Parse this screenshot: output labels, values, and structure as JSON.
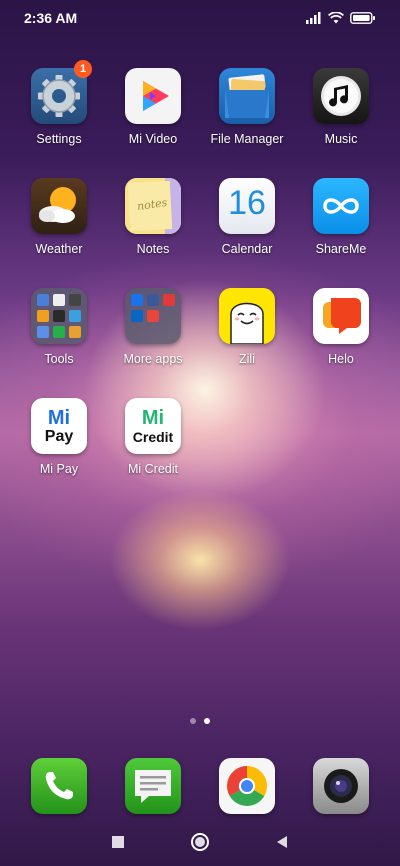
{
  "status": {
    "time": "2:36 AM",
    "icons": [
      "signal-icon",
      "wifi-icon",
      "battery-icon"
    ]
  },
  "apps": [
    {
      "label": "Settings",
      "icon": "settings-gear-icon",
      "badge": "1"
    },
    {
      "label": "Mi Video",
      "icon": "mi-video-icon"
    },
    {
      "label": "File Manager",
      "icon": "file-manager-icon"
    },
    {
      "label": "Music",
      "icon": "music-icon"
    },
    {
      "label": "Weather",
      "icon": "weather-icon"
    },
    {
      "label": "Notes",
      "icon": "notes-icon",
      "tile_text": "notes"
    },
    {
      "label": "Calendar",
      "icon": "calendar-icon",
      "tile_text": "16"
    },
    {
      "label": "ShareMe",
      "icon": "shareme-icon"
    },
    {
      "label": "Tools",
      "icon": "tools-folder-icon"
    },
    {
      "label": "More apps",
      "icon": "more-apps-folder-icon"
    },
    {
      "label": "Zili",
      "icon": "zili-icon"
    },
    {
      "label": "Helo",
      "icon": "helo-icon"
    },
    {
      "label": "Mi Pay",
      "icon": "mi-pay-icon",
      "tile_text": "Pay"
    },
    {
      "label": "Mi Credit",
      "icon": "mi-credit-icon",
      "tile_text": "Credit"
    }
  ],
  "pager": {
    "count": 2,
    "active": 2
  },
  "dock": [
    {
      "icon": "phone-icon"
    },
    {
      "icon": "messages-icon"
    },
    {
      "icon": "chrome-icon"
    },
    {
      "icon": "camera-icon"
    }
  ],
  "nav": [
    "recents-button",
    "home-button",
    "back-button"
  ]
}
